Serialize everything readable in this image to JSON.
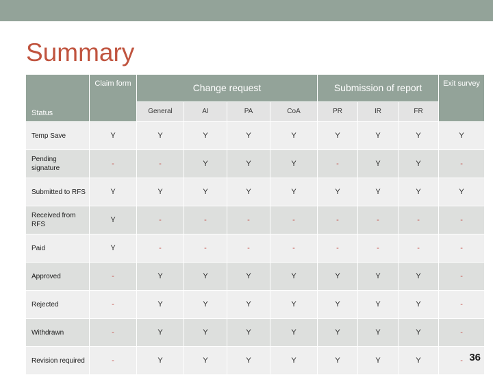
{
  "slide": {
    "title": "Summary",
    "page_number": "36",
    "accent_color": "#c0543f",
    "header_color": "#93a399",
    "subheader_color": "#e3e3e3",
    "row_light_color": "#efefef",
    "row_dark_color": "#dddfdd",
    "dash_color": "#c4504a"
  },
  "table": {
    "corner_label": "Status",
    "group_headers": [
      {
        "label": "Claim form",
        "span": 1
      },
      {
        "label": "Change request",
        "span": 4
      },
      {
        "label": "Submission of report",
        "span": 3
      },
      {
        "label": "Exit survey",
        "span": 1
      }
    ],
    "sub_headers": [
      "",
      "General",
      "AI",
      "PA",
      "CoA",
      "PR",
      "IR",
      "FR",
      ""
    ],
    "columns": [
      "Claim form",
      "Change request - General",
      "Change request - AI",
      "Change request - PA",
      "Change request - CoA",
      "Submission of report - PR",
      "Submission of report - IR",
      "Submission of report - FR",
      "Exit survey"
    ],
    "rows": [
      {
        "label": "Temp Save",
        "values": [
          "Y",
          "Y",
          "Y",
          "Y",
          "Y",
          "Y",
          "Y",
          "Y",
          "Y"
        ]
      },
      {
        "label": "Pending signature",
        "values": [
          "-",
          "-",
          "Y",
          "Y",
          "Y",
          "-",
          "Y",
          "Y",
          "-"
        ]
      },
      {
        "label": "Submitted to RFS",
        "values": [
          "Y",
          "Y",
          "Y",
          "Y",
          "Y",
          "Y",
          "Y",
          "Y",
          "Y"
        ]
      },
      {
        "label": "Received from RFS",
        "values": [
          "Y",
          "-",
          "-",
          "-",
          "-",
          "-",
          "-",
          "-",
          "-"
        ]
      },
      {
        "label": "Paid",
        "values": [
          "Y",
          "-",
          "-",
          "-",
          "-",
          "-",
          "-",
          "-",
          "-"
        ]
      },
      {
        "label": "Approved",
        "values": [
          "-",
          "Y",
          "Y",
          "Y",
          "Y",
          "Y",
          "Y",
          "Y",
          "-"
        ]
      },
      {
        "label": "Rejected",
        "values": [
          "-",
          "Y",
          "Y",
          "Y",
          "Y",
          "Y",
          "Y",
          "Y",
          "-"
        ]
      },
      {
        "label": "Withdrawn",
        "values": [
          "-",
          "Y",
          "Y",
          "Y",
          "Y",
          "Y",
          "Y",
          "Y",
          "-"
        ]
      },
      {
        "label": "Revision required",
        "values": [
          "-",
          "Y",
          "Y",
          "Y",
          "Y",
          "Y",
          "Y",
          "Y",
          "-"
        ]
      }
    ]
  }
}
